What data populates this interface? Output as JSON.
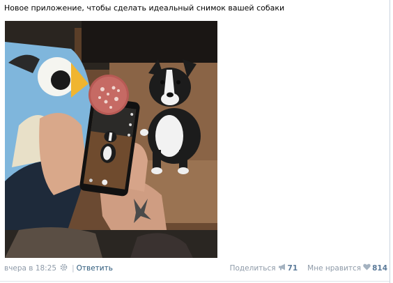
{
  "post": {
    "text": "Новое приложение, чтобы сделать идеальный снимок вашей собаки",
    "photo_alt": "Новое приложение, чтобы сделать идеальный снимок вашей собаки",
    "timestamp": "вчера в 18:25",
    "reply_label": "Ответить",
    "share_label": "Поделиться",
    "share_count": "71",
    "like_label": "Мне нравится",
    "like_count": "814"
  },
  "colors": {
    "link": "#2b587a",
    "muted": "#8e9aa8",
    "count": "#5b7a99"
  },
  "icons": {
    "settings": "gear-icon",
    "share": "megaphone-icon",
    "like": "heart-icon"
  }
}
